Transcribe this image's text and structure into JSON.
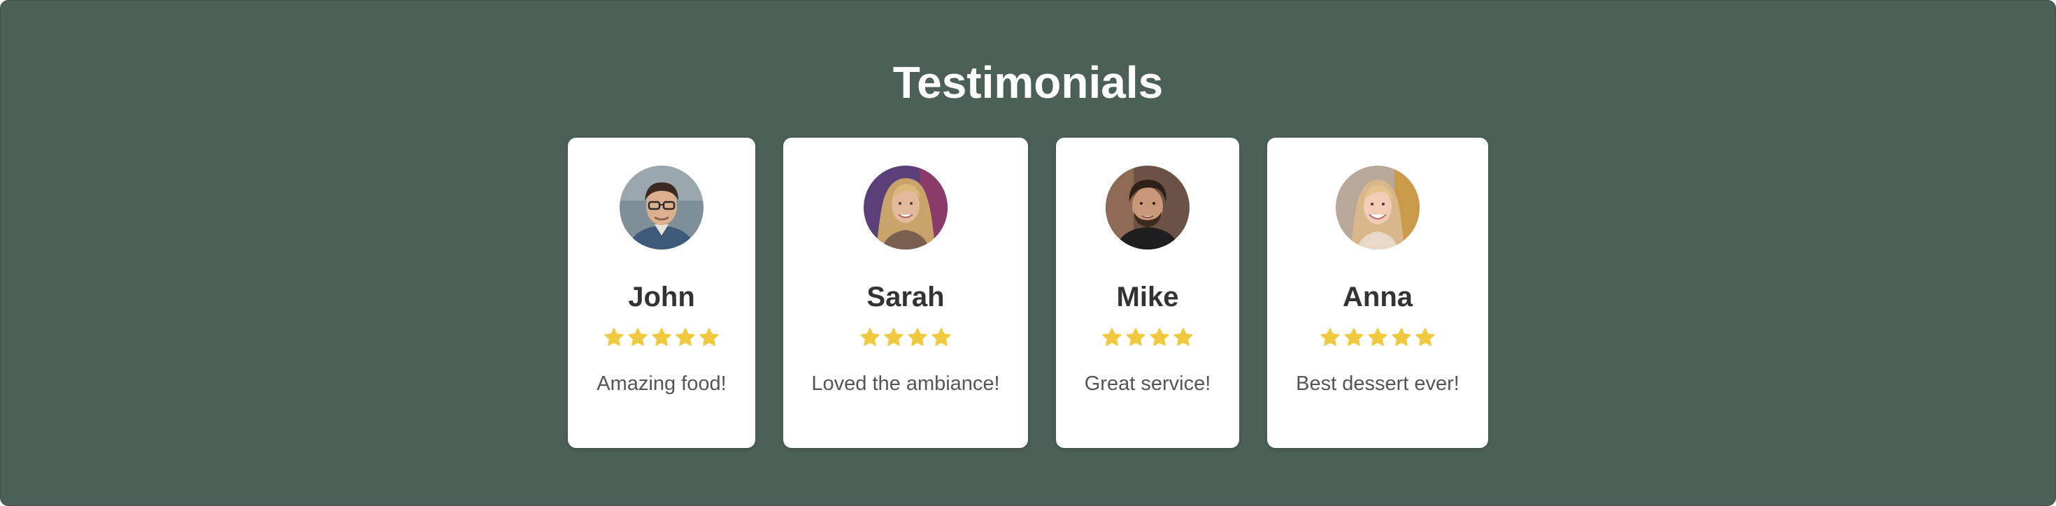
{
  "section": {
    "title": "Testimonials"
  },
  "colors": {
    "background": "#4c6058",
    "card": "#ffffff",
    "star": "#f0c93f",
    "name": "#333333",
    "text": "#555555"
  },
  "testimonials": [
    {
      "name": "John",
      "rating": 5,
      "text": "Amazing food!",
      "avatar_icon": "avatar-portrait-john"
    },
    {
      "name": "Sarah",
      "rating": 4,
      "text": "Loved the ambiance!",
      "avatar_icon": "avatar-portrait-sarah"
    },
    {
      "name": "Mike",
      "rating": 4,
      "text": "Great service!",
      "avatar_icon": "avatar-portrait-mike"
    },
    {
      "name": "Anna",
      "rating": 5,
      "text": "Best dessert ever!",
      "avatar_icon": "avatar-portrait-anna"
    }
  ]
}
